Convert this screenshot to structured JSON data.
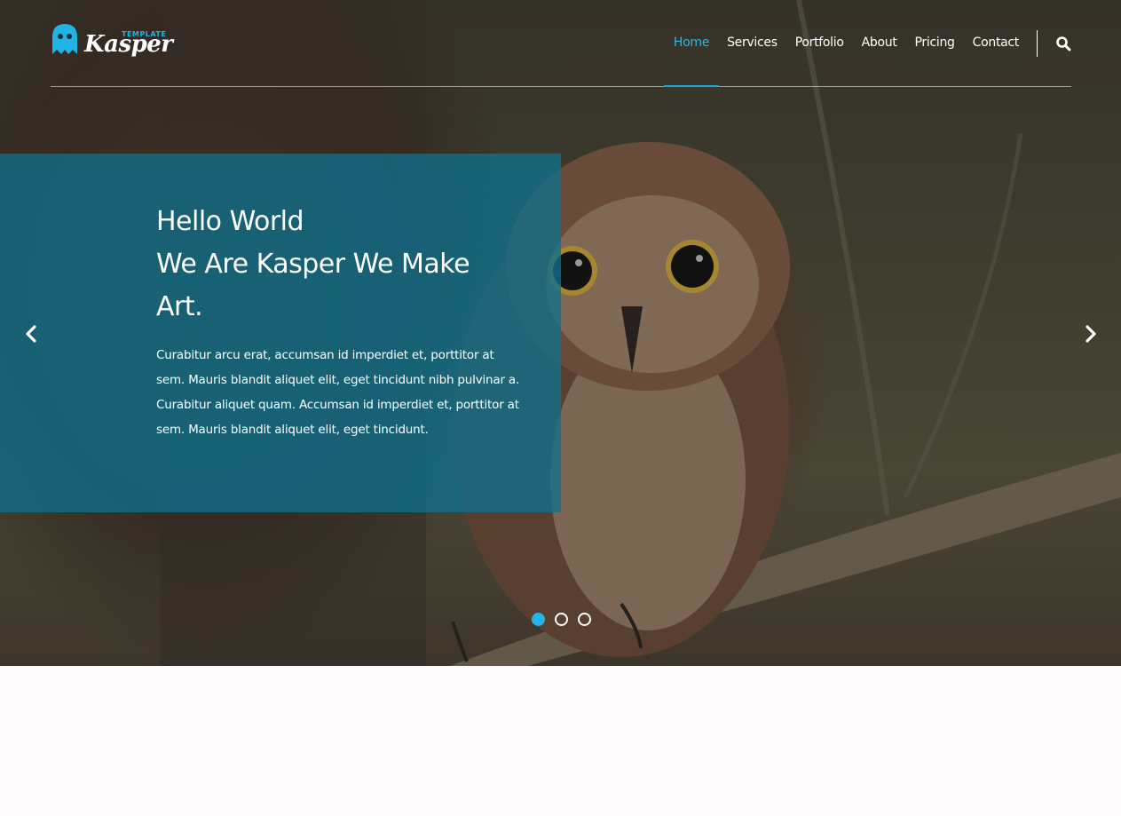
{
  "brand": {
    "name": "Kasper",
    "tag": "TEMPLATE",
    "accent_color": "#22b5ec"
  },
  "nav": {
    "items": [
      {
        "label": "Home",
        "active": true
      },
      {
        "label": "Services",
        "active": false
      },
      {
        "label": "Portfolio",
        "active": false
      },
      {
        "label": "About",
        "active": false
      },
      {
        "label": "Pricing",
        "active": false
      },
      {
        "label": "Contact",
        "active": false
      }
    ],
    "search_icon": "search-icon"
  },
  "slider": {
    "title_line1": "Hello World",
    "title_line2": "We Are Kasper We Make",
    "title_line3": "Art.",
    "text": "Curabitur arcu erat, accumsan id imperdiet et, porttitor at sem. Mauris blandit aliquet elit, eget tincidunt nibh pulvinar a. Curabitur aliquet quam. Accumsan id imperdiet et, porttitor at sem. Mauris blandit aliquet elit, eget tincidunt.",
    "prev_icon": "chevron-left-icon",
    "next_icon": "chevron-right-icon",
    "slides_count": 3,
    "active_slide": 1,
    "overlay_color": "#0f708c"
  }
}
